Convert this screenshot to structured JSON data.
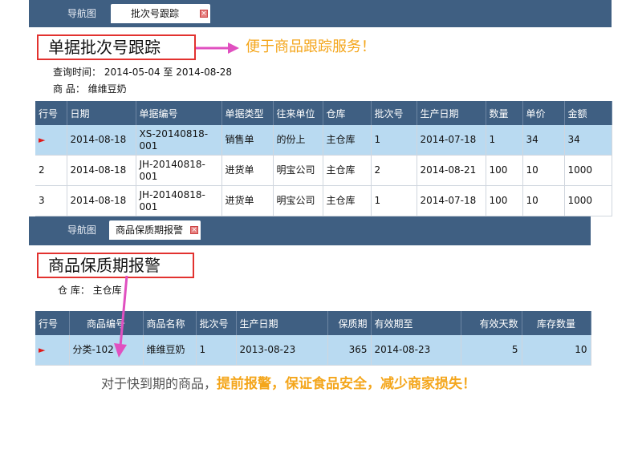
{
  "panel1": {
    "tabs": [
      {
        "label": "导航图"
      },
      {
        "label": "批次号跟踪"
      }
    ],
    "title": "单据批次号跟踪",
    "query_label": "查询时间：",
    "date_from": "2014-05-04",
    "date_sep": "至",
    "date_to": "2014-08-28",
    "product_label": "商 品：",
    "product_value": "维维豆奶",
    "callout": "便于商品跟踪服务！",
    "columns": [
      "行号",
      "日期",
      "单据编号",
      "单据类型",
      "往来单位",
      "仓库",
      "批次号",
      "生产日期",
      "数量",
      "单价",
      "金额"
    ],
    "rows": [
      [
        "",
        "2014-08-18",
        "XS-20140818-001",
        "销售单",
        "的份上",
        "主仓库",
        "1",
        "2014-07-18",
        "1",
        "34",
        "34"
      ],
      [
        "2",
        "2014-08-18",
        "JH-20140818-001",
        "进货单",
        "明宝公司",
        "主仓库",
        "2",
        "2014-08-21",
        "100",
        "10",
        "1000"
      ],
      [
        "3",
        "2014-08-18",
        "JH-20140818-001",
        "进货单",
        "明宝公司",
        "主仓库",
        "1",
        "2014-07-18",
        "100",
        "10",
        "1000"
      ]
    ]
  },
  "panel2": {
    "tabs": [
      {
        "label": "导航图"
      },
      {
        "label": "商品保质期报警"
      }
    ],
    "title": "商品保质期报警",
    "warehouse_label": "仓 库：",
    "warehouse_value": "主仓库",
    "columns": [
      "行号",
      "商品编号",
      "商品名称",
      "批次号",
      "生产日期",
      "保质期",
      "有效期至",
      "有效天数",
      "库存数量"
    ],
    "rows": [
      [
        "",
        "分类-102",
        "维维豆奶",
        "1",
        "2013-08-23",
        "365",
        "2014-08-23",
        "5",
        "10"
      ]
    ]
  },
  "footer": {
    "lead": "对于快到期的商品，",
    "highlight": "提前报警，保证食品安全，减少商家损失！"
  },
  "colors": {
    "header_bg": "#3f5f82",
    "selected_row": "#b9daf1",
    "highlight_box": "#e2322f",
    "arrow": "#e050c0",
    "callout": "#f4a61c"
  }
}
